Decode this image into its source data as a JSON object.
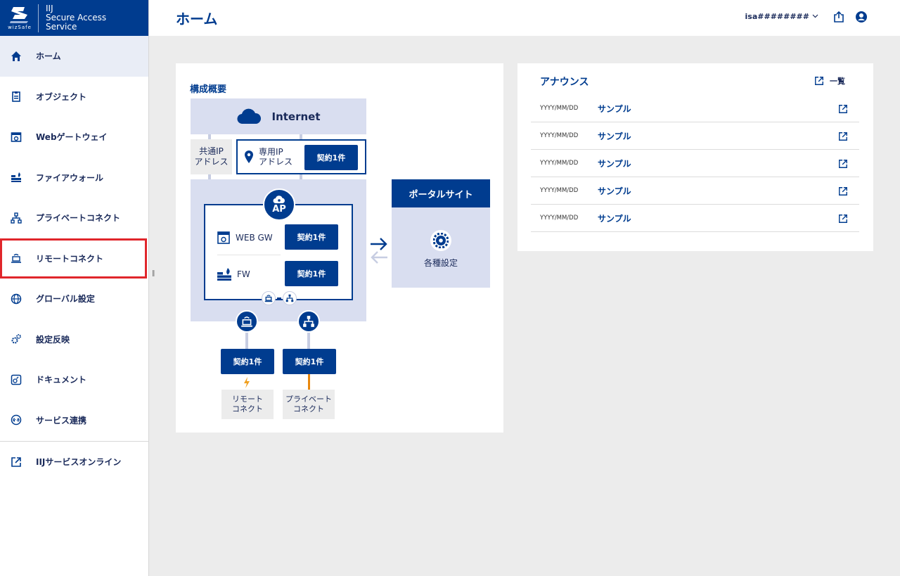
{
  "brand": {
    "logo_text": "wizSafe",
    "line1": "IIJ",
    "line2": "Secure Access",
    "line3": "Service"
  },
  "sidebar": {
    "items": [
      {
        "label": "ホーム",
        "icon": "home-icon"
      },
      {
        "label": "オブジェクト",
        "icon": "clipboard-icon"
      },
      {
        "label": "Webゲートウェイ",
        "icon": "web-gateway-icon"
      },
      {
        "label": "ファイアウォール",
        "icon": "firewall-icon"
      },
      {
        "label": "プライベートコネクト",
        "icon": "network-icon"
      },
      {
        "label": "リモートコネクト",
        "icon": "remote-connect-icon"
      },
      {
        "label": "グローバル設定",
        "icon": "globe-icon"
      },
      {
        "label": "設定反映",
        "icon": "gears-icon"
      },
      {
        "label": "ドキュメント",
        "icon": "document-icon"
      },
      {
        "label": "サービス連携",
        "icon": "link-icon"
      },
      {
        "label": "IIJサービスオンライン",
        "icon": "external-link-icon"
      }
    ]
  },
  "header": {
    "title": "ホーム",
    "user": "isa########"
  },
  "diagram": {
    "title": "構成概要",
    "internet": "Internet",
    "public_ip_line1": "共通IP",
    "public_ip_line2": "アドレス",
    "dedicated_ip_line1": "専用IP",
    "dedicated_ip_line2": "アドレス",
    "contract_label": "契約1件",
    "ap_label": "AP",
    "web_gw": "WEB GW",
    "fw": "FW",
    "remote_line1": "リモート",
    "remote_line2": "コネクト",
    "private_line1": "プライベート",
    "private_line2": "コネクト",
    "portal_title": "ポータルサイト",
    "portal_settings": "各種設定"
  },
  "announce": {
    "title": "アナウンス",
    "all_label": "一覧",
    "items": [
      {
        "date": "YYYY/MM/DD",
        "title": "サンプル"
      },
      {
        "date": "YYYY/MM/DD",
        "title": "サンプル"
      },
      {
        "date": "YYYY/MM/DD",
        "title": "サンプル"
      },
      {
        "date": "YYYY/MM/DD",
        "title": "サンプル"
      },
      {
        "date": "YYYY/MM/DD",
        "title": "サンプル"
      }
    ]
  },
  "colors": {
    "brand": "#003c8f",
    "highlight": "#e0262b",
    "panel": "#d9def0"
  }
}
